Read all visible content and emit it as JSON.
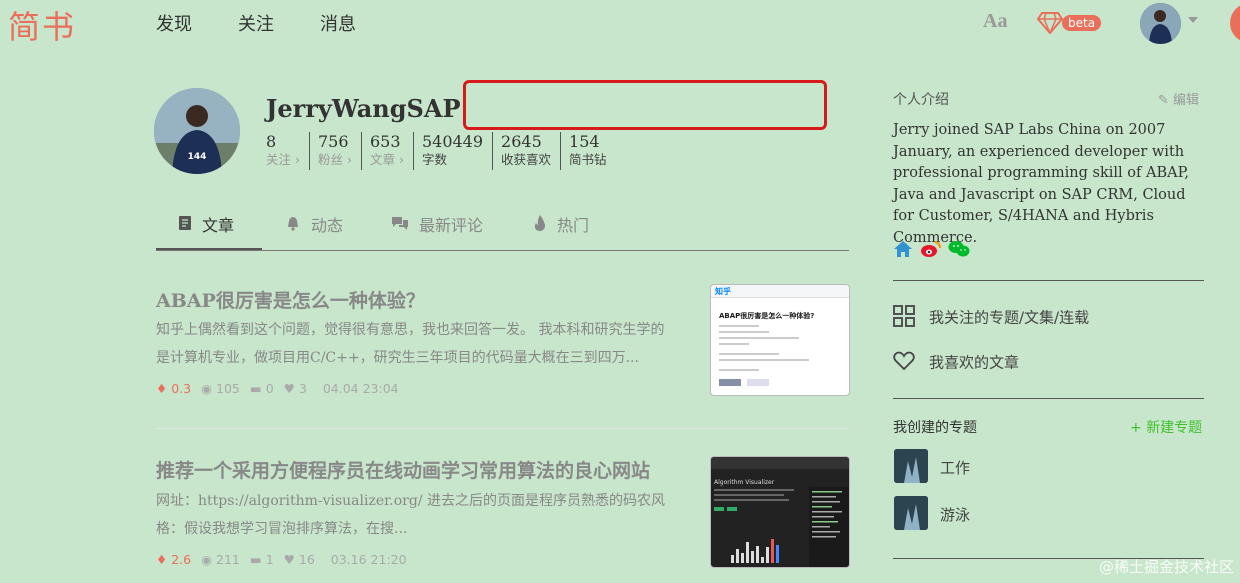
{
  "nav": {
    "logo": "简书",
    "items": [
      "发现",
      "关注",
      "消息"
    ],
    "font_toggle": "Aa",
    "beta_badge": "beta"
  },
  "profile": {
    "username": "JerryWangSAP",
    "stats": [
      {
        "value": "8",
        "label": "关注 ›"
      },
      {
        "value": "756",
        "label": "粉丝 ›"
      },
      {
        "value": "653",
        "label": "文章 ›"
      },
      {
        "value": "540449",
        "label": "字数"
      },
      {
        "value": "2645",
        "label": "收获喜欢"
      },
      {
        "value": "154",
        "label": "简书钻"
      }
    ]
  },
  "tabs": [
    {
      "label": "文章",
      "icon": "document-icon"
    },
    {
      "label": "动态",
      "icon": "bell-icon"
    },
    {
      "label": "最新评论",
      "icon": "comments-icon"
    },
    {
      "label": "热门",
      "icon": "fire-icon"
    }
  ],
  "articles": [
    {
      "title": "ABAP很厉害是怎么一种体验？",
      "abstract": "知乎上偶然看到这个问题，觉得很有意思，我也来回答一发。 我本科和研究生学的是计算机专业，做项目用C/C++，研究生三年项目的代码量大概在三到四万...",
      "diamonds": "0.3",
      "views": "105",
      "comments": "0",
      "likes": "3",
      "time": "04.04 23:04",
      "thumb": {
        "brand": "知乎",
        "headline": "ABAP很厉害是怎么一种体验?"
      }
    },
    {
      "title": "推荐一个采用方便程序员在线动画学习常用算法的良心网站",
      "abstract": "网址：https://algorithm-visualizer.org/ 进去之后的页面是程序员熟悉的码农风格：假设我想学习冒泡排序算法，在搜...",
      "diamonds": "2.6",
      "views": "211",
      "comments": "1",
      "likes": "16",
      "time": "03.16 21:20",
      "thumb": {
        "headline": "Algorithm Visualizer"
      }
    }
  ],
  "sidebar": {
    "intro_title": "个人介绍",
    "edit_label": "编辑",
    "intro_text": "Jerry joined SAP Labs China on 2007 January, an experienced developer with professional programming skill of ABAP, Java and Javascript on SAP CRM, Cloud for Customer, S/4HANA and Hybris Commerce.",
    "links": [
      {
        "label": "我关注的专题/文集/连载",
        "icon": "grid-icon"
      },
      {
        "label": "我喜欢的文章",
        "icon": "heart-icon"
      }
    ],
    "topics_title": "我创建的专题",
    "new_topic_label": "新建专题",
    "topics": [
      "工作",
      "游泳"
    ]
  },
  "watermark": "@稀土掘金技术社区",
  "colors": {
    "background": "#c7e6cb",
    "brand": "#ea6f5a",
    "green": "#42c02e",
    "highlight_box": "#d61a1a"
  }
}
